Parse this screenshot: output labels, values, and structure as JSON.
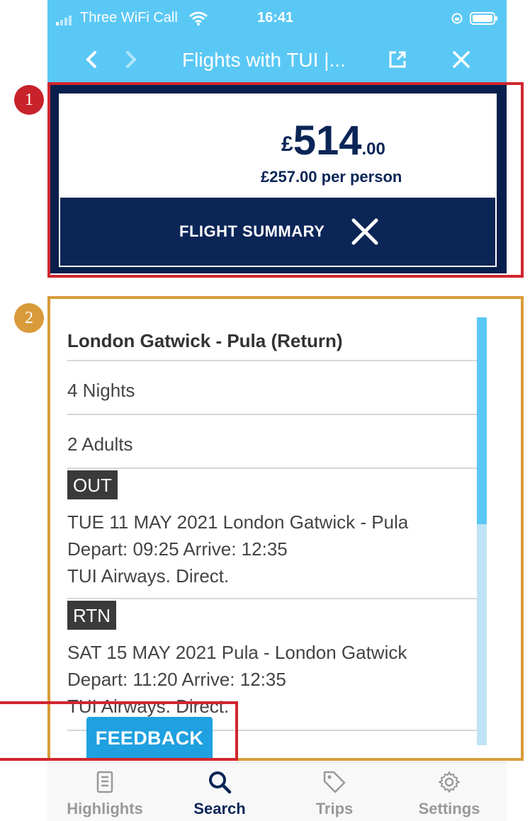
{
  "status_bar": {
    "carrier": "Three WiFi Call",
    "time": "16:41"
  },
  "browser": {
    "title": "Flights with TUI |..."
  },
  "price": {
    "currency": "£",
    "whole": "514",
    "decimal": ".00",
    "per_person": "£257.00 per person",
    "summary_label": "FLIGHT SUMMARY"
  },
  "annotations": {
    "badge_1": "1",
    "badge_2": "2"
  },
  "summary": {
    "route": "London Gatwick - Pula (Return)",
    "nights": "4 Nights",
    "passengers": "2 Adults",
    "outbound": {
      "tag": "OUT",
      "date_route": "TUE 11 MAY 2021 London Gatwick  - Pula",
      "times": "Depart: 09:25 Arrive: 12:35",
      "carrier": "TUI Airways. Direct."
    },
    "return": {
      "tag": "RTN",
      "date_route": "SAT 15 MAY 2021 Pula  - London Gatwick",
      "times": "Depart: 11:20 Arrive: 12:35",
      "carrier": "TUI Airways. Direct."
    }
  },
  "feedback_label": "FEEDBACK",
  "tabs": [
    {
      "label": "Highlights",
      "icon": "highlights-icon"
    },
    {
      "label": "Search",
      "icon": "search-icon",
      "active": true
    },
    {
      "label": "Trips",
      "icon": "tag-icon"
    },
    {
      "label": "Settings",
      "icon": "gear-icon"
    }
  ],
  "colors": {
    "header_blue": "#5ac8f5",
    "navy": "#0b2557",
    "feedback_blue": "#1fa0e0",
    "annotation_red": "#d0262f",
    "annotation_orange": "#d99b3a"
  }
}
